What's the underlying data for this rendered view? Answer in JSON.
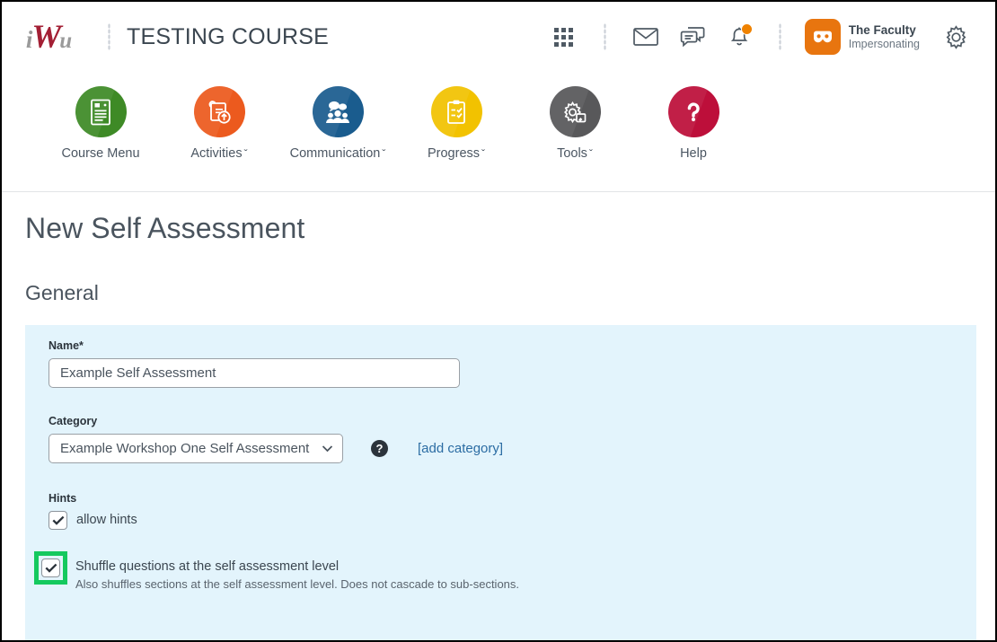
{
  "header": {
    "logo_text_i": "i",
    "logo_text_w": "W",
    "logo_text_u": "u",
    "course_title": "TESTING COURSE",
    "icons": {
      "grid": "grid-apps-icon",
      "mail": "envelope-icon",
      "chat": "chat-bubble-icon",
      "alerts": "bell-icon",
      "settings": "gear-icon",
      "avatar": "impersonation-mask-icon"
    },
    "user_name": "The Faculty",
    "user_status": "Impersonating",
    "badge_color": "#ef8200",
    "avatar_color": "#e8750f"
  },
  "nav": {
    "items": [
      {
        "label": "Course Menu",
        "caret": "",
        "color": "#3e8a26",
        "icon": "document-lines-icon"
      },
      {
        "label": "Activities",
        "caret": "ˇ",
        "color": "#ec5a1e",
        "icon": "upload-clipboard-icon"
      },
      {
        "label": "Communication",
        "caret": "ˇ",
        "color": "#1a5c8e",
        "icon": "people-chat-icon"
      },
      {
        "label": "Progress",
        "caret": "ˇ",
        "color": "#f2c200",
        "icon": "checklist-clipboard-icon"
      },
      {
        "label": "Tools",
        "caret": "ˇ",
        "color": "#58585a",
        "icon": "gear-tools-icon"
      },
      {
        "label": "Help",
        "caret": "",
        "color": "#bd0f3a",
        "icon": "question-mark-icon"
      }
    ]
  },
  "main": {
    "page_title": "New Self Assessment",
    "section_title": "General",
    "panel_color": "#e3f4fc",
    "name_field": {
      "label": "Name",
      "required_marker": "*",
      "value": "Example Self Assessment",
      "placeholder": "Example Self Assessment"
    },
    "category_field": {
      "label": "Category",
      "selected": "Example Workshop One Self Assessment",
      "help_glyph": "?",
      "add_link": "[add category]",
      "link_color": "#2b6ca3"
    },
    "hints_field": {
      "label": "Hints",
      "checkbox_label": "allow hints",
      "checked": true
    },
    "shuffle_field": {
      "checkbox_label": "Shuffle questions at the self assessment level",
      "description": "Also shuffles sections at the self assessment level. Does not cascade to sub-sections.",
      "checked": true,
      "highlight_color": "#15c95e"
    }
  }
}
